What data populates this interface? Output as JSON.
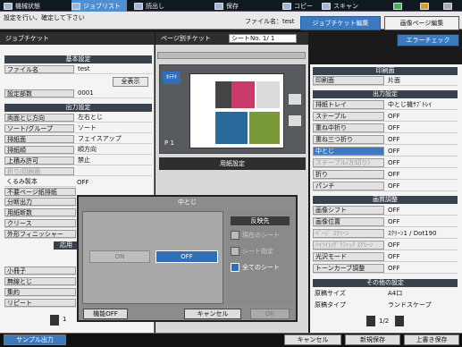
{
  "topbar": {
    "items": [
      {
        "label": "機械状態"
      },
      {
        "label": "ジョブリスト"
      },
      {
        "label": "読出し"
      },
      {
        "label": "保存"
      },
      {
        "label": "コピー"
      },
      {
        "label": "スキャン"
      }
    ]
  },
  "header": {
    "message": "設定を行い、確定して下さい",
    "filename_label": "ファイル名：test",
    "tab_job_edit": "ジョブチケット編集",
    "tab_image_edit": "画像ページ編集"
  },
  "left_panel": {
    "title": "ジョブチケット",
    "section_basic": "基本設定",
    "rows_basic": [
      {
        "label": "ファイル名",
        "value": "test"
      },
      {
        "label": "",
        "value": "全表示"
      },
      {
        "label": "設定部数",
        "value": "0001"
      }
    ],
    "section_output": "出力設定",
    "rows_output": [
      {
        "label": "両面とじ方向",
        "value": "左右とじ"
      },
      {
        "label": "ソート/グループ",
        "value": "ソート"
      },
      {
        "label": "排紙面",
        "value": "フェイスアップ"
      },
      {
        "label": "排紙順",
        "value": "順方向"
      },
      {
        "label": "上積み許可",
        "value": "禁止"
      },
      {
        "label": "折り/印刷面",
        "value": ""
      },
      {
        "label": "くるみ製本",
        "value": "OFF"
      },
      {
        "label": "不要ページ紙排紙",
        "value": ""
      },
      {
        "label": "分断出力",
        "value": ""
      },
      {
        "label": "用紙断数",
        "value": ""
      },
      {
        "label": "クリース",
        "value": ""
      },
      {
        "label": "外形フィニッシャー",
        "value": ""
      }
    ],
    "section_apply": "応用",
    "rows_apply": [
      {
        "label": "小冊子",
        "value": ""
      },
      {
        "label": "無線とじ",
        "value": ""
      },
      {
        "label": "集約",
        "value": ""
      },
      {
        "label": "リピート",
        "value": ""
      }
    ],
    "page_indicator": "1"
  },
  "center": {
    "title": "ページ別チケット",
    "sheet_no_label": "シートNo.",
    "sheet_no_value": "1/ 1",
    "preview_tag": "ﾎﾃﾁｷ",
    "page_label": "P 1",
    "paper_settings_label": "用紙設定"
  },
  "right_panel": {
    "error_check": "エラーチェック",
    "section_print": "印刷面",
    "rows_print": [
      {
        "label": "印刷面",
        "value": "片面"
      }
    ],
    "section_output": "出力設定",
    "rows_output": [
      {
        "label": "排紙トレイ",
        "value": "中とじ機ｻﾌﾞﾄﾚｲ"
      },
      {
        "label": "ステープル",
        "value": "OFF"
      },
      {
        "label": "重ね中折り",
        "value": "OFF"
      },
      {
        "label": "重ね三つ折り",
        "value": "OFF"
      },
      {
        "label": "中とじ",
        "value": "OFF"
      },
      {
        "label": "ステープル(左切り)",
        "value": "OFF"
      },
      {
        "label": "折り",
        "value": "OFF"
      },
      {
        "label": "パンチ",
        "value": "OFF"
      }
    ],
    "section_image": "画質調整",
    "rows_image": [
      {
        "label": "画像シフト",
        "value": "OFF"
      },
      {
        "label": "画像位置",
        "value": "OFF"
      },
      {
        "label": "ﾍﾟｰｼﾞ ｽｸﾘｰﾝ",
        "value": "ｽｸﾘｰﾝ1 / Dot190"
      },
      {
        "label": "ﾊｲﾗｲﾄ/ｸﾞﾗﾌｨｯｸ ｽｸﾘｰﾝ",
        "value": "OFF"
      },
      {
        "label": "光沢モード",
        "value": "OFF"
      },
      {
        "label": "トーンカーブ調整",
        "value": "OFF"
      }
    ],
    "section_other": "その他の設定",
    "rows_other": [
      {
        "label": "原稿サイズ",
        "value": "A4口"
      },
      {
        "label": "原稿タイプ",
        "value": "ランドスケープ"
      }
    ],
    "page_indicator": "1/2"
  },
  "dialog": {
    "title": "中とじ",
    "on_label": "ON",
    "off_label": "OFF",
    "apply_title": "反映先",
    "apply_options": [
      {
        "label": "現在のシート",
        "checked": false
      },
      {
        "label": "シート指定",
        "checked": false
      },
      {
        "label": "全てのシート",
        "checked": true
      }
    ],
    "function_off": "機能OFF",
    "cancel": "キャンセル",
    "ok": "OK"
  },
  "bottombar": {
    "sample_output": "サンプル出力",
    "cancel": "キャンセル",
    "save_new": "新規保存",
    "overwrite_save": "上書き保存"
  },
  "colors": {
    "accent": "#3b7ac0",
    "dark_header": "#2e2e2e",
    "section_header": "#39424c"
  }
}
